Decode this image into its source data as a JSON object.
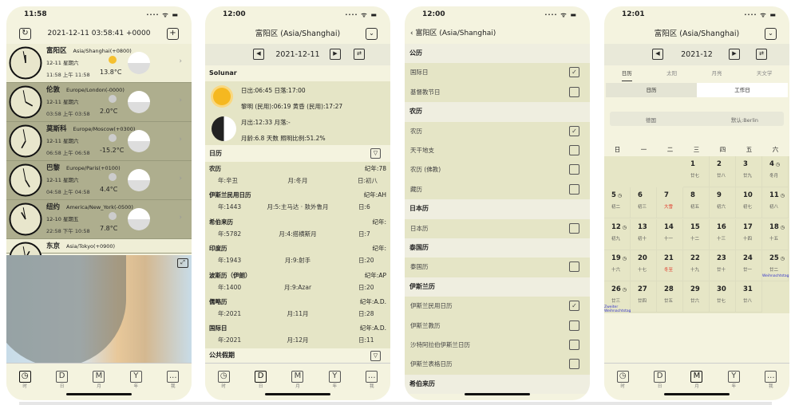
{
  "accent": {
    "panel": "#f4f3df",
    "list": "#e5e5c6",
    "dark_row": "#aeae8e",
    "holiday_red": "#e03c2c"
  },
  "tabbar": [
    {
      "label": "时",
      "icon": "clock-icon"
    },
    {
      "label": "日",
      "icon": "D"
    },
    {
      "label": "月",
      "icon": "M"
    },
    {
      "label": "年",
      "icon": "Y"
    },
    {
      "label": "我",
      "icon": "..."
    }
  ],
  "screen1": {
    "time": "11:58",
    "title": "2021-12-11 03:58:41 +0000",
    "refresh_icon": "↻",
    "add_icon": "+",
    "clocks": [
      {
        "name": "富阳区",
        "tz": "Asia/Shanghai(+0800)",
        "date": "12-11 星期六",
        "time": "11:58  上午 11:58",
        "temp": "13.8°C",
        "hour": 11.97,
        "day": true
      },
      {
        "name": "伦敦",
        "tz": "Europe/London(-0000)",
        "date": "12-11 星期六",
        "time": "03:58  上午 03:58",
        "temp": "2.0°C",
        "hour": 3.97,
        "day": false
      },
      {
        "name": "莫斯科",
        "tz": "Europe/Moscow(+0300)",
        "date": "12-11 星期六",
        "time": "06:58  上午 06:58",
        "temp": "-15.2°C",
        "hour": 6.97,
        "day": false
      },
      {
        "name": "巴黎",
        "tz": "Europe/Paris(+0100)",
        "date": "12-11 星期六",
        "time": "04:58  上午 04:58",
        "temp": "4.4°C",
        "hour": 4.97,
        "day": false
      },
      {
        "name": "纽约",
        "tz": "America/New_York(-0500)",
        "date": "12-10 星期五",
        "time": "22:58  下午 10:58",
        "temp": "7.8°C",
        "hour": 10.97,
        "day": false
      },
      {
        "name": "东京",
        "tz": "Asia/Tokyo(+0900)",
        "date": "",
        "time": "",
        "temp": "",
        "hour": 12.97,
        "day": true
      }
    ]
  },
  "screen2": {
    "time": "12:00",
    "title": "富阳区 (Asia/Shanghai)",
    "date": "2021-12-11",
    "solunar_header": "Solunar",
    "sun1": "日出:06:45 日落:17:00",
    "sun2": "黎明 (民用):06:19 黄昏 (民用):17:27",
    "moon1": "月出:12:33 月落:-",
    "moon2": "月龄:6.8 天数 照明比例:51.2%",
    "calendar_header": "日历",
    "holiday_header": "公共假期",
    "calendars": [
      {
        "name": "农历",
        "era": "纪年:78",
        "y": "年:辛丑",
        "m": "月:冬月",
        "d": "日:初八"
      },
      {
        "name": "伊斯兰民用日历",
        "era": "纪年:AH",
        "y": "年:1443",
        "m": "月:5:主马达 · 敖外鲁月",
        "d": "日:6"
      },
      {
        "name": "希伯来历",
        "era": "纪年:",
        "y": "年:5782",
        "m": "月:4:搭横斯月",
        "d": "日:7"
      },
      {
        "name": "印度历",
        "era": "纪年:",
        "y": "年:1943",
        "m": "月:9:射手",
        "d": "日:20"
      },
      {
        "name": "波斯历（伊朗）",
        "era": "纪年:AP",
        "y": "年:1400",
        "m": "月:9:Azar",
        "d": "日:20"
      },
      {
        "name": "儒略历",
        "era": "纪年:A.D.",
        "y": "年:2021",
        "m": "月:11月",
        "d": "日:28"
      },
      {
        "name": "国际日",
        "era": "纪年:A.D.",
        "y": "年:2021",
        "m": "月:12月",
        "d": "日:11"
      }
    ]
  },
  "screen3": {
    "time": "12:00",
    "back_title": "富阳区 (Asia/Shanghai)",
    "items": [
      {
        "label": "公历",
        "section": true
      },
      {
        "label": "国际日",
        "checked": true
      },
      {
        "label": "基督教节日",
        "checked": false
      },
      {
        "label": "农历",
        "section": true
      },
      {
        "label": "农历",
        "checked": true
      },
      {
        "label": "天干地支",
        "checked": false
      },
      {
        "label": "农历 (佛教)",
        "checked": false
      },
      {
        "label": "藏历",
        "checked": false
      },
      {
        "label": "日本历",
        "section": true
      },
      {
        "label": "日本历",
        "checked": false
      },
      {
        "label": "泰国历",
        "section": true
      },
      {
        "label": "泰国历",
        "checked": false
      },
      {
        "label": "伊斯兰历",
        "section": true
      },
      {
        "label": "伊斯兰民用日历",
        "checked": true
      },
      {
        "label": "伊斯兰教历",
        "checked": false
      },
      {
        "label": "沙特阿拉伯伊斯兰日历",
        "checked": false
      },
      {
        "label": "伊斯兰表格日历",
        "checked": false
      },
      {
        "label": "希伯来历",
        "section": true
      }
    ]
  },
  "screen4": {
    "time": "12:01",
    "title": "富阳区 (Asia/Shanghai)",
    "month": "2021-12",
    "tabs": [
      "日历",
      "太阳",
      "月亮",
      "天文学"
    ],
    "segments": [
      "日历",
      "工作日"
    ],
    "country": "德国",
    "region": "默认:Berlin",
    "weekdays": [
      "日",
      "一",
      "二",
      "三",
      "四",
      "五",
      "六"
    ],
    "days": [
      {
        "n": "1",
        "l": "廿七"
      },
      {
        "n": "2",
        "l": "廿八"
      },
      {
        "n": "3",
        "l": "廿九"
      },
      {
        "n": "4",
        "l": "冬月",
        "clock": true
      },
      {
        "n": "5",
        "l": "初二",
        "clock": true
      },
      {
        "n": "6",
        "l": "初三"
      },
      {
        "n": "7",
        "l": "大雪",
        "red": true
      },
      {
        "n": "8",
        "l": "初五"
      },
      {
        "n": "9",
        "l": "初六"
      },
      {
        "n": "10",
        "l": "初七"
      },
      {
        "n": "11",
        "l": "初八",
        "clock": true
      },
      {
        "n": "12",
        "l": "初九",
        "clock": true
      },
      {
        "n": "13",
        "l": "初十"
      },
      {
        "n": "14",
        "l": "十一"
      },
      {
        "n": "15",
        "l": "十二"
      },
      {
        "n": "16",
        "l": "十三"
      },
      {
        "n": "17",
        "l": "十四"
      },
      {
        "n": "18",
        "l": "十五",
        "clock": true
      },
      {
        "n": "19",
        "l": "十六",
        "clock": true
      },
      {
        "n": "20",
        "l": "十七"
      },
      {
        "n": "21",
        "l": "冬至",
        "red": true
      },
      {
        "n": "22",
        "l": "十九"
      },
      {
        "n": "23",
        "l": "廿十"
      },
      {
        "n": "24",
        "l": "廿一"
      },
      {
        "n": "25",
        "l": "廿二",
        "clock": true,
        "holiday": "Weihnachtstag"
      },
      {
        "n": "26",
        "l": "廿三",
        "clock": true,
        "holiday": "Zweiter Weihnachtstag"
      },
      {
        "n": "27",
        "l": "廿四"
      },
      {
        "n": "28",
        "l": "廿五"
      },
      {
        "n": "29",
        "l": "廿六"
      },
      {
        "n": "30",
        "l": "廿七"
      },
      {
        "n": "31",
        "l": "廿八"
      }
    ]
  }
}
